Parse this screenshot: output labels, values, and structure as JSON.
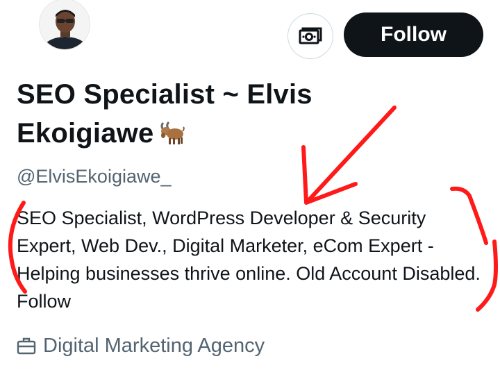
{
  "profile": {
    "name_line1": "SEO Specialist ~ Elvis",
    "name_line2": "Ekoigiawe",
    "name_emoji_icon": "goat-icon",
    "handle": "@ElvisEkoigiawe_",
    "bio": "SEO Specialist, WordPress Developer & Security Expert, Web Dev., Digital Marketer, eCom Expert - Helping businesses thrive online. Old Account Disabled. Follow",
    "category": "Digital Marketing Agency",
    "category_icon": "briefcase-icon"
  },
  "actions": {
    "subscribe_icon": "money-icon",
    "follow_label": "Follow"
  },
  "annotations": {
    "stroke_color": "#ff1a1a"
  }
}
